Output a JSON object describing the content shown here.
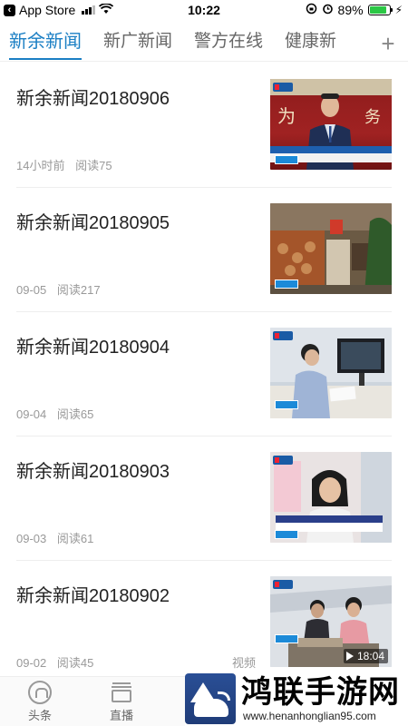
{
  "status_bar": {
    "back_app": "App Store",
    "time": "10:22",
    "battery_percent": "89%",
    "battery_level": 0.89
  },
  "tabs": [
    {
      "label": "新余新闻",
      "active": true
    },
    {
      "label": "新广新闻",
      "active": false
    },
    {
      "label": "警方在线",
      "active": false
    },
    {
      "label": "健康新",
      "active": false
    }
  ],
  "add_tab_symbol": "+",
  "news": [
    {
      "title": "新余新闻20180906",
      "time": "14小时前",
      "reads": "阅读75",
      "thumb_scene": "anchor"
    },
    {
      "title": "新余新闻20180905",
      "time": "09-05",
      "reads": "阅读217",
      "thumb_scene": "woodshop"
    },
    {
      "title": "新余新闻20180904",
      "time": "09-04",
      "reads": "阅读65",
      "thumb_scene": "desk"
    },
    {
      "title": "新余新闻20180903",
      "time": "09-03",
      "reads": "阅读61",
      "thumb_scene": "interview"
    },
    {
      "title": "新余新闻20180902",
      "time": "09-02",
      "reads": "阅读45",
      "thumb_scene": "workshop",
      "video_label": "视频",
      "duration": "18:04"
    }
  ],
  "bottom_nav": [
    {
      "label": "头条",
      "icon": "home-icon"
    },
    {
      "label": "直播",
      "icon": "tv-icon"
    }
  ],
  "watermark": {
    "title": "鸿联手游网",
    "url": "www.henanhonglian95.com"
  },
  "colors": {
    "accent": "#1b7fc4",
    "battery": "#2bc745",
    "meta_text": "#999999"
  }
}
